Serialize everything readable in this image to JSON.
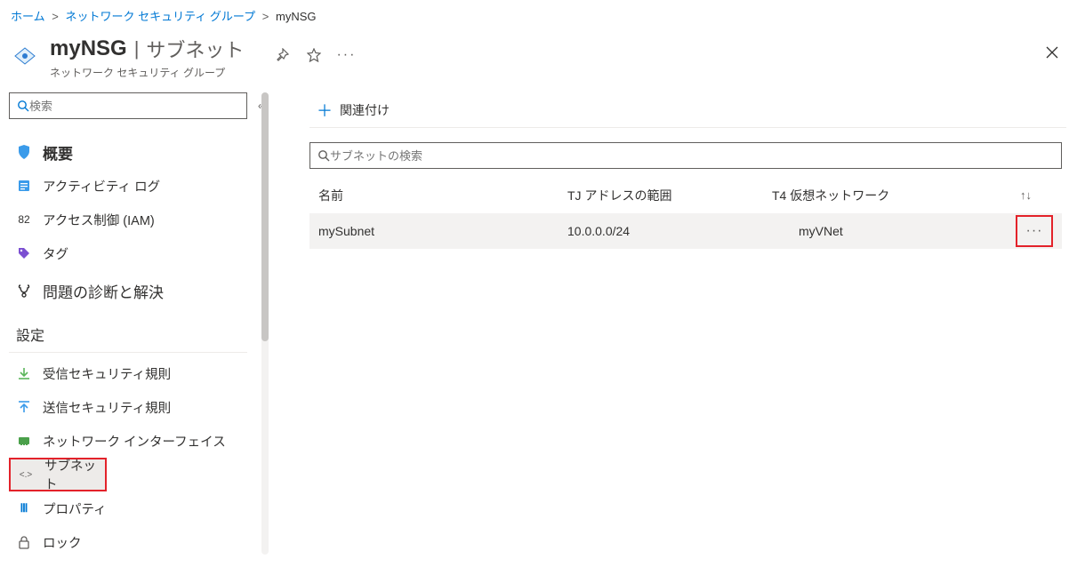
{
  "breadcrumb": {
    "items": [
      "ホーム",
      "ネットワーク セキュリティ グループ"
    ],
    "current": "myNSG"
  },
  "header": {
    "title": "myNSG",
    "separator": "|",
    "page": "サブネット",
    "subtitle": "ネットワーク セキュリティ グループ"
  },
  "sidebar": {
    "search_placeholder": "検索",
    "items_top": [
      {
        "label": "概要",
        "icon": "shield"
      },
      {
        "label": "アクティビティ ログ",
        "icon": "activity"
      },
      {
        "label": "アクセス制御 (IAM)",
        "icon": "iam",
        "prefix": "82"
      },
      {
        "label": "タグ",
        "icon": "tag"
      },
      {
        "label": "問題の診断と解決",
        "icon": "diagnose"
      }
    ],
    "section_settings": "設定",
    "items_settings": [
      {
        "label": "受信セキュリティ規則",
        "icon": "inbound"
      },
      {
        "label": "送信セキュリティ規則",
        "icon": "outbound"
      },
      {
        "label": "ネットワーク インターフェイス",
        "icon": "nic"
      },
      {
        "label": "サブネット",
        "icon": "subnet",
        "selected": true,
        "highlight": true
      },
      {
        "label": "プロパティ",
        "icon": "properties"
      },
      {
        "label": "ロック",
        "icon": "lock"
      }
    ]
  },
  "toolbar": {
    "associate_label": "関連付け"
  },
  "subnet_search_placeholder": "サブネットの検索",
  "table": {
    "columns": [
      "名前",
      "TJ アドレスの範囲",
      "T4 仮想ネットワーク"
    ],
    "rows": [
      {
        "name": "mySubnet",
        "range": "10.0.0.0/24",
        "vnet": "myVNet"
      }
    ]
  }
}
